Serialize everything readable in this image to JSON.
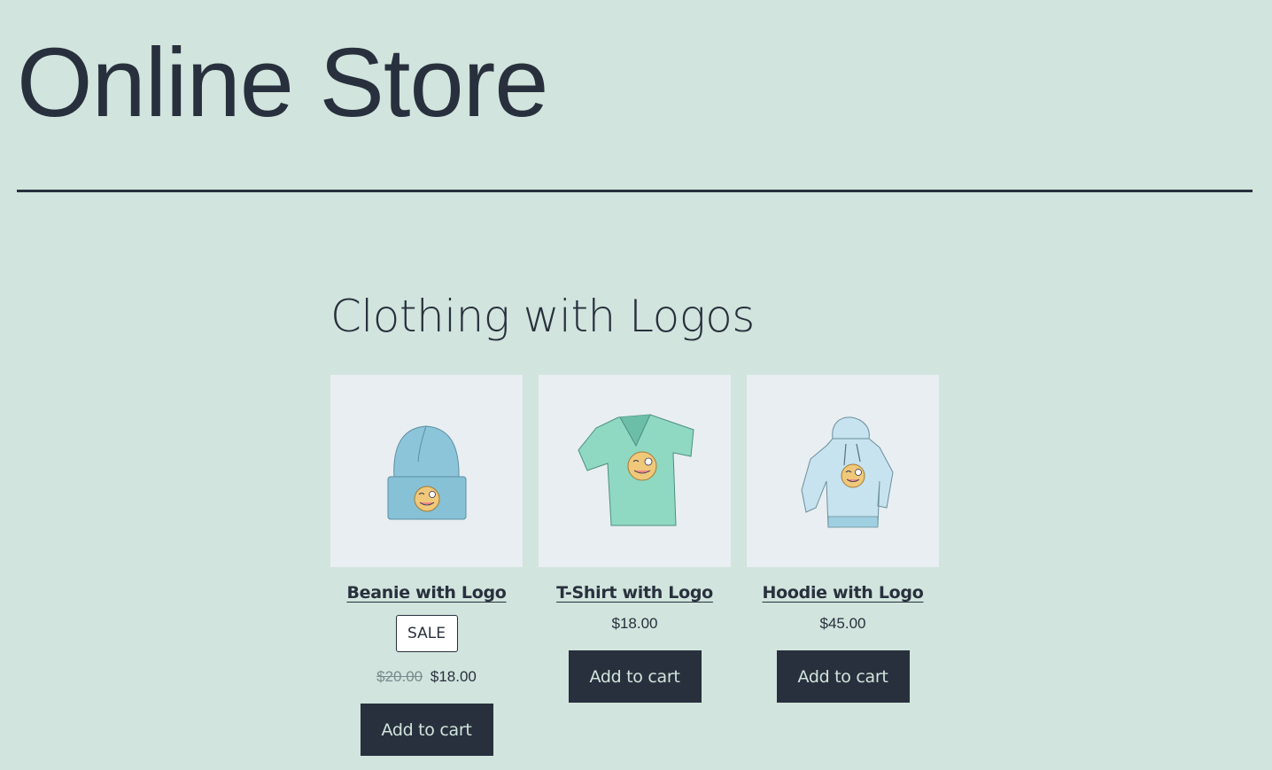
{
  "site": {
    "title": "Online Store"
  },
  "section": {
    "title": "Clothing with Logos"
  },
  "colors": {
    "background": "#d1e4dd",
    "text": "#28303d",
    "thumb_bg": "#e8eef1",
    "button_bg": "#28303d",
    "button_text": "#d1e4dd"
  },
  "products": [
    {
      "name": "Beanie with Logo",
      "image": "beanie-with-logo-image",
      "on_sale": true,
      "sale_badge": "SALE",
      "regular_price": "$20.00",
      "price": "$18.00",
      "button_label": "Add to cart"
    },
    {
      "name": "T-Shirt with Logo",
      "image": "tshirt-with-logo-image",
      "on_sale": false,
      "price": "$18.00",
      "button_label": "Add to cart"
    },
    {
      "name": "Hoodie with Logo",
      "image": "hoodie-with-logo-image",
      "on_sale": false,
      "price": "$45.00",
      "button_label": "Add to cart"
    }
  ]
}
